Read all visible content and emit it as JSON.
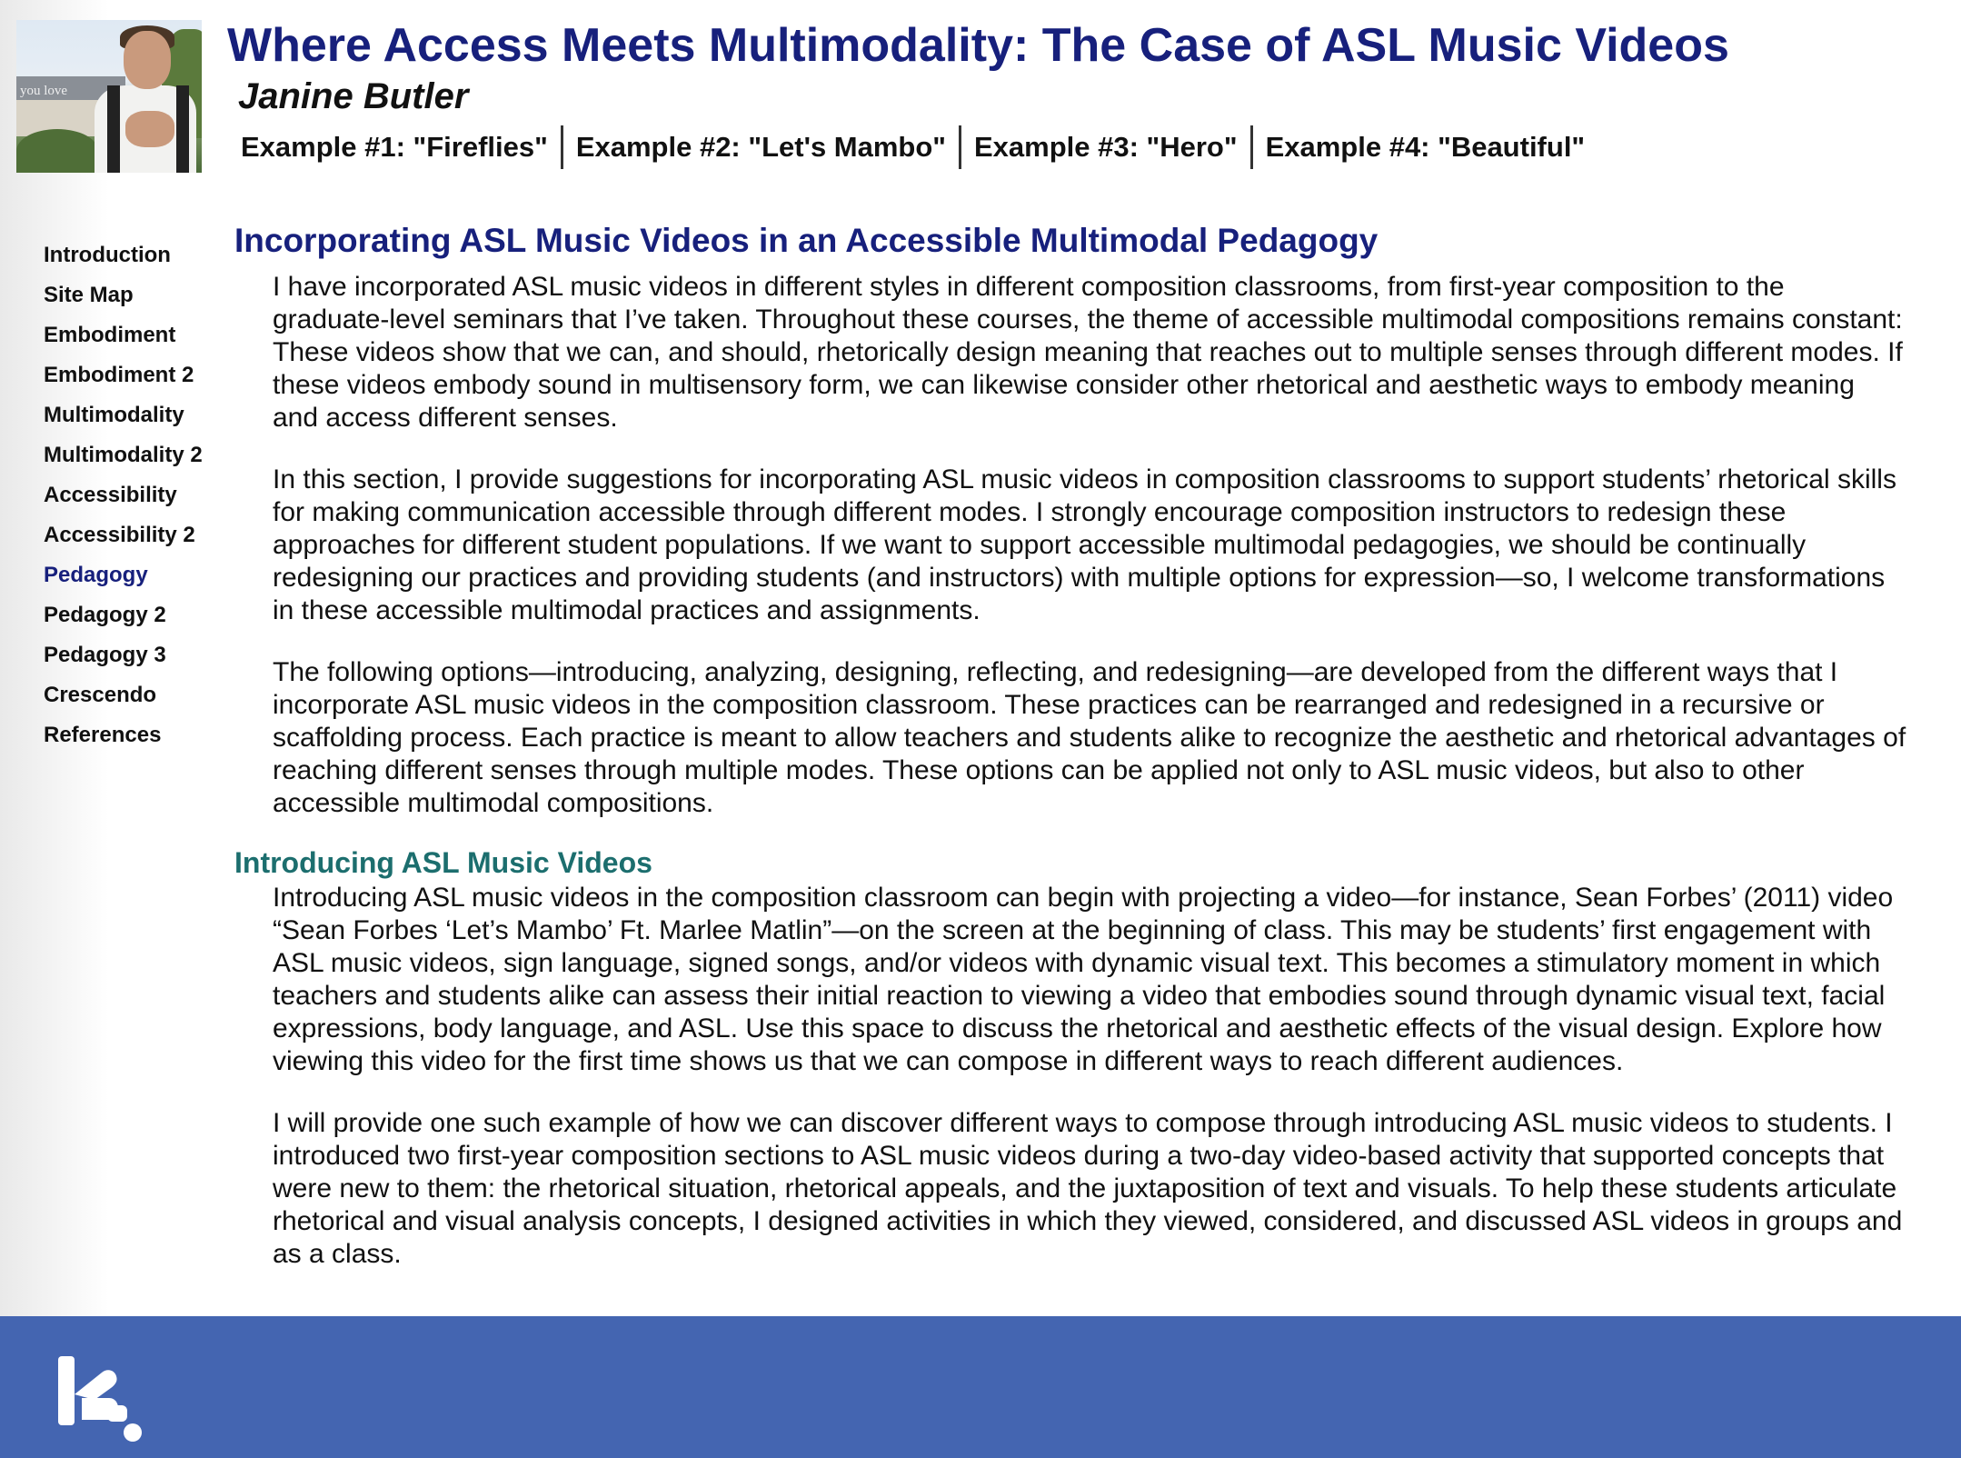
{
  "header": {
    "thumbnail_caption": "you love",
    "site_title": "Where Access Meets Multimodality: The Case of ASL Music Videos",
    "author": "Janine Butler",
    "examples": [
      {
        "label": "Example #1: \"Fireflies\""
      },
      {
        "label": "Example #2: \"Let's Mambo\""
      },
      {
        "label": "Example #3: \"Hero\""
      },
      {
        "label": "Example #4: \"Beautiful\""
      }
    ]
  },
  "sidebar": {
    "items": [
      {
        "label": "Introduction"
      },
      {
        "label": "Site Map"
      },
      {
        "label": "Embodiment"
      },
      {
        "label": "Embodiment 2"
      },
      {
        "label": "Multimodality"
      },
      {
        "label": "Multimodality 2"
      },
      {
        "label": "Accessibility"
      },
      {
        "label": "Accessibility 2"
      },
      {
        "label": "Pedagogy",
        "current": true
      },
      {
        "label": "Pedagogy 2"
      },
      {
        "label": "Pedagogy 3"
      },
      {
        "label": "Crescendo"
      },
      {
        "label": "References"
      }
    ]
  },
  "main": {
    "section_title": "Incorporating ASL Music Videos in an Accessible Multimodal Pedagogy",
    "paragraphs": [
      "I have incorporated ASL music videos in different styles in different composition classrooms, from first-year composition to the graduate-level seminars that I’ve taken. Throughout these courses, the theme of accessible multimodal compositions remains constant: These videos show that we can, and should, rhetorically design meaning that reaches out to multiple senses through different modes. If these videos embody sound in multisensory form, we can likewise consider other rhetorical and aesthetic ways to embody meaning and access different senses.",
      "In this section, I provide suggestions for incorporating ASL music videos in composition classrooms to support students’ rhetorical skills for making communication accessible through different modes. I strongly encourage composition instructors to redesign these approaches for different student populations. If we want to support accessible multimodal pedagogies, we should be continually redesigning our practices and providing students (and instructors) with multiple options for expression—so, I welcome transformations in these accessible multimodal practices and assignments.",
      "The following options—introducing, analyzing, designing, reflecting, and redesigning—are developed from the different ways that I incorporate ASL music videos in the composition classroom. These practices can be rearranged and redesigned in a recursive or scaffolding process. Each practice is meant to allow teachers and students alike to recognize the aesthetic and rhetorical advantages of reaching different senses through multiple modes. These options can be applied not only to ASL music videos, but also to other accessible multimodal compositions."
    ],
    "subsection_title": "Introducing ASL Music Videos",
    "sub_paragraphs": [
      "Introducing ASL music videos in the composition classroom can begin with projecting a video—for instance, Sean Forbes’ (2011) video “Sean Forbes ‘Let’s Mambo’ Ft. Marlee Matlin”—on the screen at the beginning of class. This may be students’ first engagement with ASL music videos, sign language, signed songs, and/or videos with dynamic visual text. This becomes a stimulatory moment in which teachers and students alike can assess their initial reaction to viewing a video that embodies sound through dynamic visual text, facial expressions, body language, and ASL. Use this space to discuss the rhetorical and aesthetic effects of the visual design. Explore how viewing this video for the first time shows us that we can compose in different ways to reach different audiences.",
      "I will provide one such example of how we can discover different ways to compose through introducing ASL music videos to students. I introduced two first-year composition sections to ASL music videos during a two-day video-based activity that supported concepts that were new to them: the rhetorical situation, rhetorical appeals, and the juxtaposition of text and visuals. To help these students articulate rhetorical and visual analysis concepts, I designed activities in which they viewed, considered, and discussed ASL videos in groups and as a class."
    ]
  },
  "footer": {
    "logo_icon": "kairos-logo-icon",
    "background_color": "#4465b1"
  },
  "colors": {
    "title": "#17207c",
    "subtitle": "#1c6e6e",
    "current_nav": "#17207c"
  }
}
